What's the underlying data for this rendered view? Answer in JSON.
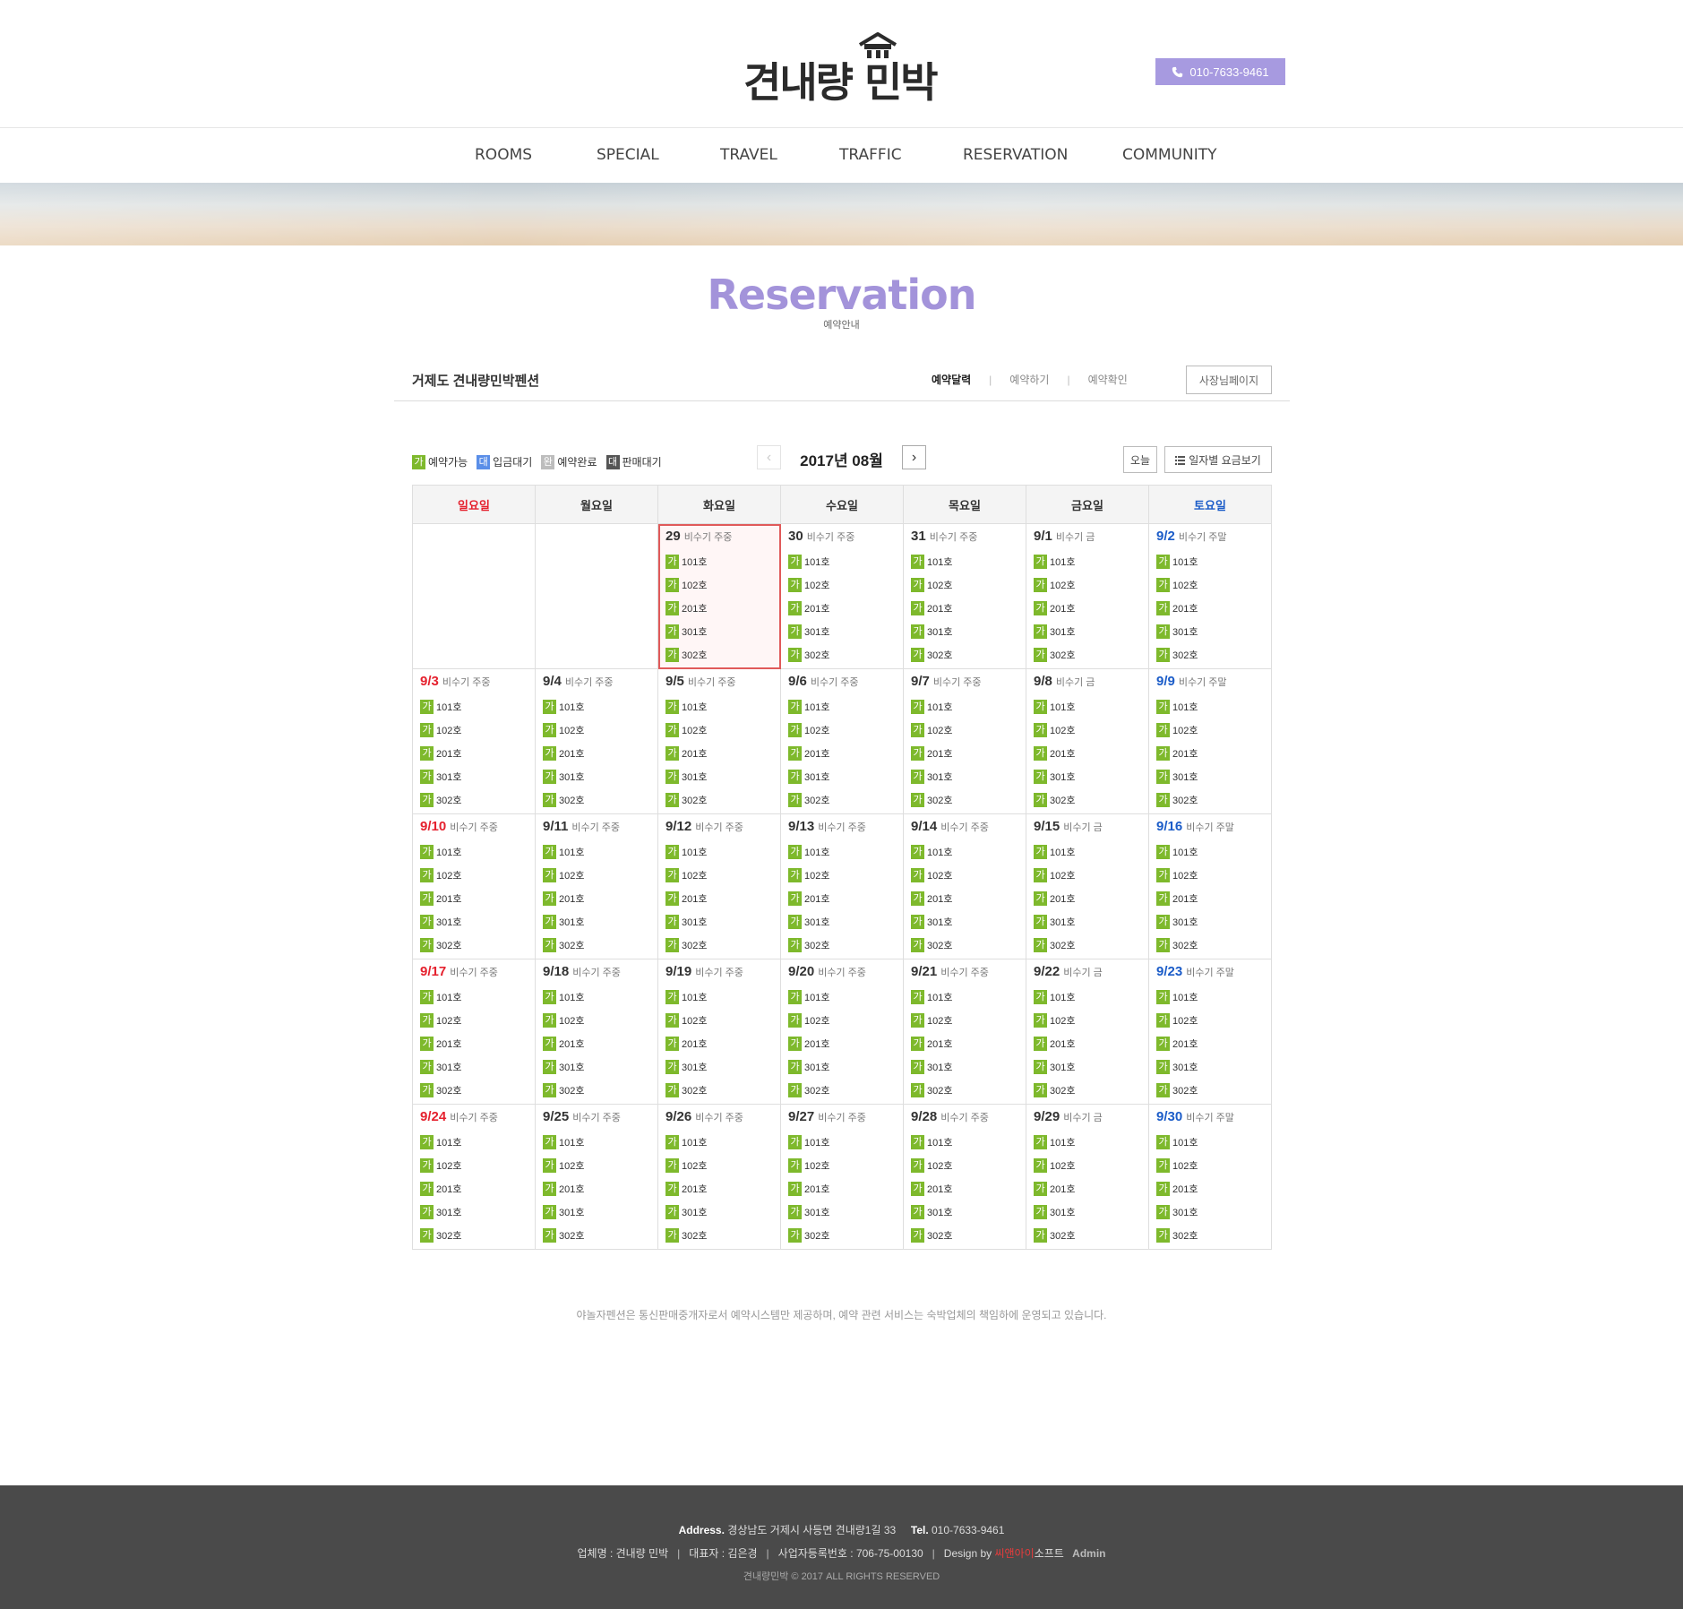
{
  "header": {
    "logo_text": "견내량 민박",
    "phone": "010-7633-9461"
  },
  "nav": [
    "ROOMS",
    "SPECIAL",
    "TRAVEL",
    "TRAFFIC",
    "RESERVATION",
    "COMMUNITY"
  ],
  "page": {
    "title": "Reservation",
    "subtitle": "예약안내"
  },
  "sub_header": {
    "shop_name": "거제도 견내량민박펜션",
    "tabs": [
      "예약달력",
      "예약하기",
      "예약확인"
    ],
    "active_tab": "예약달력",
    "owner_button": "사장님페이지"
  },
  "legend": [
    {
      "badge": "가",
      "label": "예약가능",
      "color": "#7eb92c"
    },
    {
      "badge": "대",
      "label": "입금대기",
      "color": "#5a8ee8"
    },
    {
      "badge": "완",
      "label": "예약완료",
      "color": "#bdbdbd"
    },
    {
      "badge": "대",
      "label": "판매대기",
      "color": "#555555"
    }
  ],
  "calendar": {
    "month_label": "2017년 08월",
    "today_button": "오늘",
    "price_button": "일자별 요금보기",
    "weekdays": [
      "일요일",
      "월요일",
      "화요일",
      "수요일",
      "목요일",
      "금요일",
      "토요일"
    ],
    "status_badge": "가",
    "rooms": [
      "101호",
      "102호",
      "201호",
      "301호",
      "302호"
    ],
    "weeks": [
      [
        null,
        null,
        {
          "date": "29",
          "season": "비수기 주중",
          "today": true
        },
        {
          "date": "30",
          "season": "비수기 주중"
        },
        {
          "date": "31",
          "season": "비수기 주중"
        },
        {
          "date": "9/1",
          "season": "비수기 금"
        },
        {
          "date": "9/2",
          "season": "비수기 주말"
        }
      ],
      [
        {
          "date": "9/3",
          "season": "비수기 주중"
        },
        {
          "date": "9/4",
          "season": "비수기 주중"
        },
        {
          "date": "9/5",
          "season": "비수기 주중"
        },
        {
          "date": "9/6",
          "season": "비수기 주중"
        },
        {
          "date": "9/7",
          "season": "비수기 주중"
        },
        {
          "date": "9/8",
          "season": "비수기 금"
        },
        {
          "date": "9/9",
          "season": "비수기 주말"
        }
      ],
      [
        {
          "date": "9/10",
          "season": "비수기 주중"
        },
        {
          "date": "9/11",
          "season": "비수기 주중"
        },
        {
          "date": "9/12",
          "season": "비수기 주중"
        },
        {
          "date": "9/13",
          "season": "비수기 주중"
        },
        {
          "date": "9/14",
          "season": "비수기 주중"
        },
        {
          "date": "9/15",
          "season": "비수기 금"
        },
        {
          "date": "9/16",
          "season": "비수기 주말"
        }
      ],
      [
        {
          "date": "9/17",
          "season": "비수기 주중"
        },
        {
          "date": "9/18",
          "season": "비수기 주중"
        },
        {
          "date": "9/19",
          "season": "비수기 주중"
        },
        {
          "date": "9/20",
          "season": "비수기 주중"
        },
        {
          "date": "9/21",
          "season": "비수기 주중"
        },
        {
          "date": "9/22",
          "season": "비수기 금"
        },
        {
          "date": "9/23",
          "season": "비수기 주말"
        }
      ],
      [
        {
          "date": "9/24",
          "season": "비수기 주중"
        },
        {
          "date": "9/25",
          "season": "비수기 주중"
        },
        {
          "date": "9/26",
          "season": "비수기 주중"
        },
        {
          "date": "9/27",
          "season": "비수기 주중"
        },
        {
          "date": "9/28",
          "season": "비수기 주중"
        },
        {
          "date": "9/29",
          "season": "비수기 금"
        },
        {
          "date": "9/30",
          "season": "비수기 주말"
        }
      ]
    ]
  },
  "notice": "야놀자펜션은 통신판매중개자로서 예약시스템만 제공하며, 예약 관련 서비스는 숙박업체의 책임하에 운영되고 있습니다.",
  "footer": {
    "address_label": "Address.",
    "address": "경상남도 거제시 사등면 견내량1길 33",
    "tel_label": "Tel.",
    "tel": "010-7633-9461",
    "company": "업체명 : 견내량 민박",
    "ceo": "대표자 : 김은경",
    "biz_no": "사업자등록번호 : 706-75-00130",
    "design_by": "Design by",
    "designer_red": "씨앤아이",
    "designer_rest": "소프트",
    "admin": "Admin",
    "copyright": "견내량민박 © 2017 ALL RIGHTS RESERVED"
  },
  "colors": {
    "accent": "#a393da",
    "phone_button": "#a79ae0",
    "available": "#7eb92c",
    "sunday": "#e5212e",
    "saturday": "#1b5cc8",
    "footer_bg": "#4a4a4a"
  }
}
